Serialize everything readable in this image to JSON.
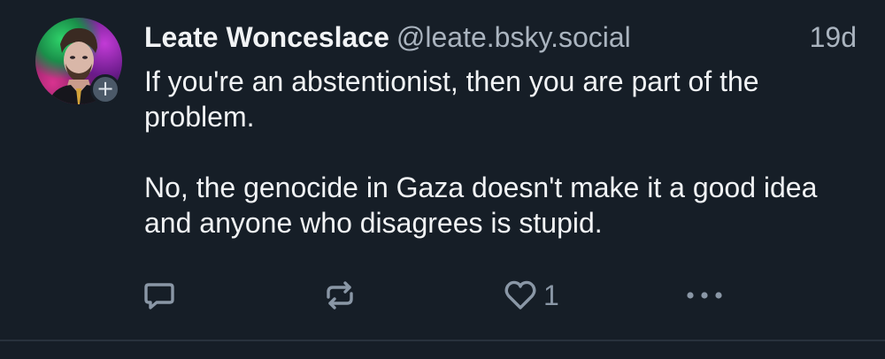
{
  "post": {
    "author": {
      "display_name": "Leate Wonceslace",
      "handle": "@leate.bsky.social",
      "avatar_icon": "avatar-portrait"
    },
    "timestamp": "19d",
    "text": "If you're an abstentionist, then you are part of the problem.\n\nNo, the genocide in Gaza doesn't make it a good idea and anyone who disagrees is stupid.",
    "follow_badge": "+",
    "actions": {
      "reply_icon": "reply-icon",
      "repost_icon": "repost-icon",
      "like_icon": "heart-icon",
      "like_count": "1",
      "more_icon": "more-options-icon"
    }
  },
  "colors": {
    "background": "#161e27",
    "text_primary": "#f1f3f5",
    "text_secondary": "#aab4bf",
    "icon": "#8a97a6"
  }
}
